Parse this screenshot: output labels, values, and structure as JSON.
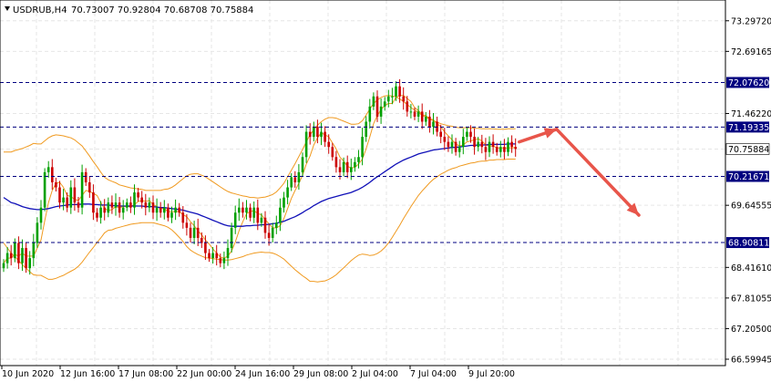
{
  "header": {
    "symbol_timeframe": "USDRUB,H4",
    "ohlc": "70.73007 70.92804 70.68708 70.75884"
  },
  "chart_data": {
    "type": "candlestick",
    "title": "USDRUB,H4",
    "ylim": [
      66.59945,
      73.6
    ],
    "price_ticks": [
      "73.29720",
      "72.69165",
      "72.07620",
      "71.46220",
      "71.19335",
      "70.75884",
      "70.21671",
      "69.64555",
      "68.90811",
      "68.41610",
      "67.81055",
      "67.20500",
      "66.59945"
    ],
    "time_labels": [
      "10 Jun 2020",
      "12 Jun 16:00",
      "17 Jun 08:00",
      "22 Jun 00:00",
      "24 Jun 16:00",
      "29 Jun 08:00",
      "2 Jul 04:00",
      "7 Jul 04:00",
      "9 Jul 20:00"
    ],
    "horizontal_levels": [
      72.0762,
      71.19335,
      70.21671,
      68.90811
    ],
    "level_labels": [
      "72.07620",
      "71.19335",
      "70.21671",
      "68.90811"
    ],
    "current_price": 70.75884,
    "current_price_label": "70.75884",
    "closes": [
      68.5,
      68.7,
      68.6,
      68.9,
      68.5,
      68.8,
      68.4,
      68.6,
      68.9,
      69.3,
      69.6,
      70.3,
      70.4,
      70.1,
      70.0,
      69.7,
      69.8,
      69.6,
      70.0,
      69.7,
      69.6,
      70.3,
      70.1,
      69.9,
      69.5,
      69.4,
      69.6,
      69.5,
      69.7,
      69.6,
      69.7,
      69.5,
      69.6,
      69.7,
      69.6,
      69.9,
      69.8,
      69.7,
      69.6,
      69.7,
      69.5,
      69.6,
      69.5,
      69.6,
      69.4,
      69.5,
      69.6,
      69.5,
      69.3,
      69.2,
      69.0,
      69.2,
      69.0,
      68.9,
      68.7,
      68.6,
      68.7,
      68.6,
      68.5,
      68.6,
      68.8,
      69.2,
      69.5,
      69.6,
      69.5,
      69.6,
      69.4,
      69.6,
      69.3,
      69.4,
      69.1,
      69.0,
      69.2,
      69.3,
      69.6,
      69.8,
      70.0,
      70.2,
      70.1,
      70.3,
      70.6,
      71.1,
      71.0,
      71.2,
      71.0,
      71.1,
      70.9,
      70.8,
      70.6,
      70.4,
      70.3,
      70.5,
      70.3,
      70.4,
      70.5,
      70.6,
      71.0,
      71.3,
      71.6,
      71.8,
      71.4,
      71.6,
      71.7,
      71.8,
      71.8,
      72.0,
      71.8,
      71.7,
      71.5,
      71.5,
      71.4,
      71.5,
      71.3,
      71.4,
      71.2,
      71.3,
      71.1,
      71.0,
      70.9,
      70.8,
      70.9,
      70.7,
      70.8,
      71.0,
      71.1,
      71.0,
      70.8,
      70.9,
      70.8,
      70.7,
      70.9,
      70.8,
      70.7,
      70.8,
      70.7,
      70.9,
      70.8,
      70.76
    ],
    "ma": [
      69.8,
      69.75,
      69.7,
      69.68,
      69.65,
      69.62,
      69.6,
      69.58,
      69.57,
      69.56,
      69.56,
      69.57,
      69.58,
      69.6,
      69.62,
      69.63,
      69.64,
      69.65,
      69.66,
      69.66,
      69.66,
      69.67,
      69.67,
      69.67,
      69.66,
      69.66,
      69.65,
      69.65,
      69.65,
      69.64,
      69.64,
      69.63,
      69.63,
      69.63,
      69.63,
      69.63,
      69.63,
      69.63,
      69.62,
      69.62,
      69.62,
      69.61,
      69.6,
      69.6,
      69.59,
      69.58,
      69.57,
      69.56,
      69.55,
      69.53,
      69.51,
      69.49,
      69.47,
      69.44,
      69.41,
      69.38,
      69.35,
      69.32,
      69.29,
      69.26,
      69.24,
      69.23,
      69.23,
      69.23,
      69.23,
      69.24,
      69.24,
      69.25,
      69.25,
      69.26,
      69.26,
      69.27,
      69.28,
      69.29,
      69.31,
      69.33,
      69.36,
      69.39,
      69.42,
      69.46,
      69.5,
      69.55,
      69.59,
      69.64,
      69.68,
      69.72,
      69.75,
      69.78,
      69.8,
      69.82,
      69.84,
      69.86,
      69.88,
      69.9,
      69.93,
      69.96,
      70.0,
      70.05,
      70.1,
      70.16,
      70.21,
      70.26,
      70.31,
      70.36,
      70.41,
      70.46,
      70.5,
      70.54,
      70.57,
      70.6,
      70.63,
      70.66,
      70.68,
      70.7,
      70.72,
      70.74,
      70.75,
      70.76,
      70.77,
      70.78,
      70.79,
      70.79,
      70.8,
      70.81,
      70.82,
      70.83,
      70.83,
      70.84,
      70.84,
      70.84,
      70.85,
      70.85,
      70.85,
      70.85,
      70.85,
      70.86,
      70.86,
      70.86
    ],
    "bb_width": [
      0.9,
      0.95,
      1.0,
      1.05,
      1.1,
      1.15,
      1.2,
      1.25,
      1.3,
      1.3,
      1.3,
      1.35,
      1.4,
      1.42,
      1.42,
      1.4,
      1.38,
      1.35,
      1.32,
      1.28,
      1.22,
      1.15,
      1.05,
      0.95,
      0.85,
      0.75,
      0.65,
      0.55,
      0.5,
      0.48,
      0.45,
      0.42,
      0.4,
      0.38,
      0.36,
      0.35,
      0.34,
      0.33,
      0.32,
      0.32,
      0.32,
      0.33,
      0.34,
      0.36,
      0.38,
      0.42,
      0.48,
      0.55,
      0.62,
      0.7,
      0.75,
      0.78,
      0.8,
      0.8,
      0.8,
      0.78,
      0.76,
      0.74,
      0.72,
      0.7,
      0.68,
      0.66,
      0.64,
      0.62,
      0.6,
      0.58,
      0.56,
      0.55,
      0.54,
      0.54,
      0.55,
      0.56,
      0.58,
      0.62,
      0.68,
      0.75,
      0.85,
      0.95,
      1.05,
      1.15,
      1.25,
      1.35,
      1.45,
      1.5,
      1.55,
      1.58,
      1.6,
      1.6,
      1.58,
      1.55,
      1.5,
      1.45,
      1.4,
      1.35,
      1.32,
      1.3,
      1.32,
      1.38,
      1.45,
      1.5,
      1.52,
      1.52,
      1.5,
      1.46,
      1.4,
      1.33,
      1.25,
      1.16,
      1.07,
      0.98,
      0.9,
      0.82,
      0.75,
      0.69,
      0.63,
      0.58,
      0.54,
      0.5,
      0.47,
      0.44,
      0.42,
      0.4,
      0.38,
      0.37,
      0.36,
      0.35,
      0.34,
      0.33,
      0.32,
      0.32,
      0.31,
      0.31,
      0.3,
      0.3,
      0.3,
      0.3,
      0.3,
      0.3
    ],
    "forecast_arrows": [
      {
        "from_index": 138,
        "from_price": 70.9,
        "to_index": 148,
        "to_price": 71.15
      },
      {
        "from_index": 148,
        "from_price": 71.15,
        "to_index": 170,
        "to_price": 69.45
      }
    ],
    "colors": {
      "background": "#ffffff",
      "grid": "#e6e6e6",
      "bull": "#00a000",
      "bear": "#cc0000",
      "ma": "#1010b8",
      "bands": "#f09a20",
      "level_line": "#000080",
      "level_label_bg": "#000080",
      "arrow": "#e8554a"
    }
  }
}
